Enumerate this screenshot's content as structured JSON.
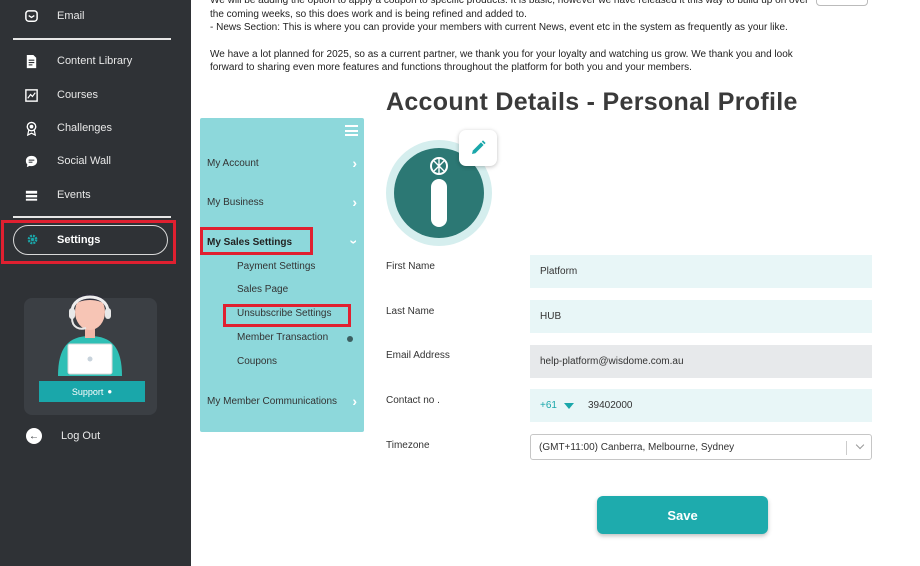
{
  "sidebar": {
    "items": [
      {
        "label": "Email",
        "icon": "email-icon"
      },
      {
        "label": "Content Library",
        "icon": "document-icon"
      },
      {
        "label": "Courses",
        "icon": "courses-icon"
      },
      {
        "label": "Challenges",
        "icon": "award-icon"
      },
      {
        "label": "Social Wall",
        "icon": "chat-icon"
      },
      {
        "label": "Events",
        "icon": "events-icon"
      }
    ],
    "settings_label": "Settings",
    "support_label": "Support",
    "logout_label": "Log Out"
  },
  "announcement": {
    "line1": "We will be adding the option to apply a coupon to specific products. It is basic, however we have released it this way to build up on over the coming weeks, so this does work and is being refined and added to.",
    "line2": "- News Section: This is where you can provide your members with current News, event etc in the system as frequently as your like.",
    "line3": "We have a lot planned for 2025, so as a current partner, we thank you for your loyalty and watching us grow. We thank you and look forward to sharing even more features and functions throughout the platform for both you and your members."
  },
  "submenu": {
    "my_account": "My Account",
    "my_business": "My Business",
    "my_sales_settings": "My Sales Settings",
    "payment_settings": "Payment Settings",
    "sales_page": "Sales Page",
    "unsubscribe_settings": "Unsubscribe Settings",
    "member_transaction": "Member Transaction",
    "coupons": "Coupons",
    "my_member_communications": "My Member Communications"
  },
  "profile": {
    "title": "Account Details - Personal Profile",
    "first_name_label": "First Name",
    "first_name": "Platform",
    "last_name_label": "Last Name",
    "last_name": "HUB",
    "email_label": "Email Address",
    "email": "help-platform@wisdome.com.au",
    "contact_label": "Contact no .",
    "country_code": "+61",
    "phone": "39402000",
    "timezone_label": "Timezone",
    "timezone": "(GMT+11:00) Canberra, Melbourne, Sydney",
    "save_label": "Save"
  },
  "colors": {
    "sidebar_bg": "#2f3236",
    "accent": "#1eabad",
    "submenu_bg": "#8dd8db",
    "highlight": "#e02030"
  }
}
